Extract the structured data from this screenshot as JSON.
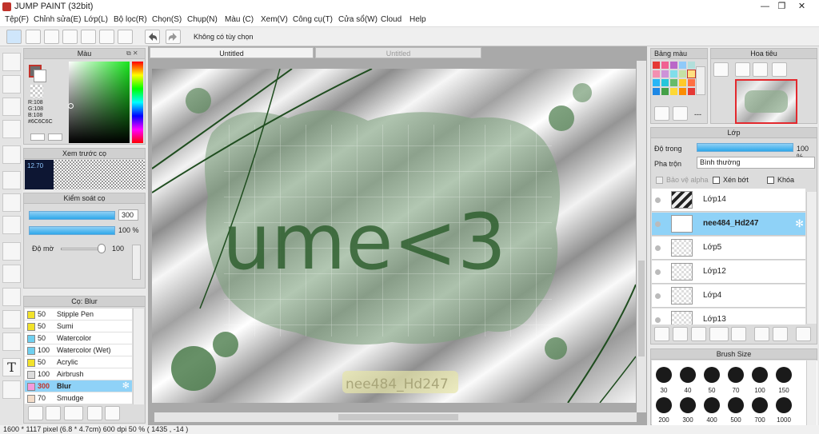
{
  "app": {
    "title": "JUMP PAINT (32bit)"
  },
  "menu": [
    "Tệp(F)",
    "Chỉnh sửa(E)",
    "Lớp(L)",
    "Bộ lọc(R)",
    "Chọn(S)",
    "Chụp(N)",
    "Màu (C)",
    "Xem(V)",
    "Công cụ(T)",
    "Cửa sổ(W)",
    "Cloud",
    "Help"
  ],
  "toolbar": {
    "no_option": "Không có tùy chọn"
  },
  "color_panel": {
    "title": "Màu",
    "r": "R:108",
    "g": "G:108",
    "b": "B:108",
    "hex": "#6C6C6C",
    "current": "#6c6c6c"
  },
  "preview_panel": {
    "title": "Xem trước cọ",
    "zoom": "12.70"
  },
  "brush_control": {
    "title": "Kiểm soát cọ",
    "size": "300",
    "opacity": "100 %",
    "hardness_label": "Độ mờ",
    "hardness": "100"
  },
  "brush_list": {
    "title": "Cọ: Blur",
    "items": [
      {
        "size": "50",
        "name": "Stipple Pen",
        "color": "#f2e22a"
      },
      {
        "size": "50",
        "name": "Sumi",
        "color": "#f2e22a"
      },
      {
        "size": "50",
        "name": "Watercolor",
        "color": "#6fd0f0"
      },
      {
        "size": "100",
        "name": "Watercolor (Wet)",
        "color": "#6fd0f0"
      },
      {
        "size": "50",
        "name": "Acrylic",
        "color": "#f2e22a"
      },
      {
        "size": "100",
        "name": "Airbrush",
        "color": "#dcdcdc"
      },
      {
        "size": "300",
        "name": "Blur",
        "color": "#f59adc"
      },
      {
        "size": "70",
        "name": "Smudge",
        "color": "#f4ddc9"
      }
    ]
  },
  "document": {
    "tab1": "Untitled",
    "tab2": "Untitled",
    "canvas_text": "ume<3",
    "watermark": "nee484_Hd247"
  },
  "palette": {
    "title": "Bảng màu",
    "more": "---"
  },
  "navigator": {
    "title": "Hoa tiêu"
  },
  "layers": {
    "title": "Lớp",
    "opacity_label": "Độ trong",
    "opacity": "100 %",
    "blend_label": "Pha trộn",
    "blend": "Bình thường",
    "protect_alpha": "Bảo vệ alpha",
    "clip": "Xén bớt",
    "lock": "Khóa",
    "items": [
      "Lớp14",
      "nee484_Hd247",
      "Lớp5",
      "Lớp12",
      "Lớp4",
      "Lớp13"
    ]
  },
  "brush_size": {
    "title": "Brush Size",
    "row1": [
      "30",
      "40",
      "50",
      "70",
      "100",
      "150"
    ],
    "row2": [
      "200",
      "300",
      "400",
      "500",
      "700",
      "1000"
    ]
  },
  "status": {
    "text": "1600 * 1117 pixel   (6.8 * 4.7cm)   600 dpi   50 %   ( 1435 , -14 )"
  }
}
